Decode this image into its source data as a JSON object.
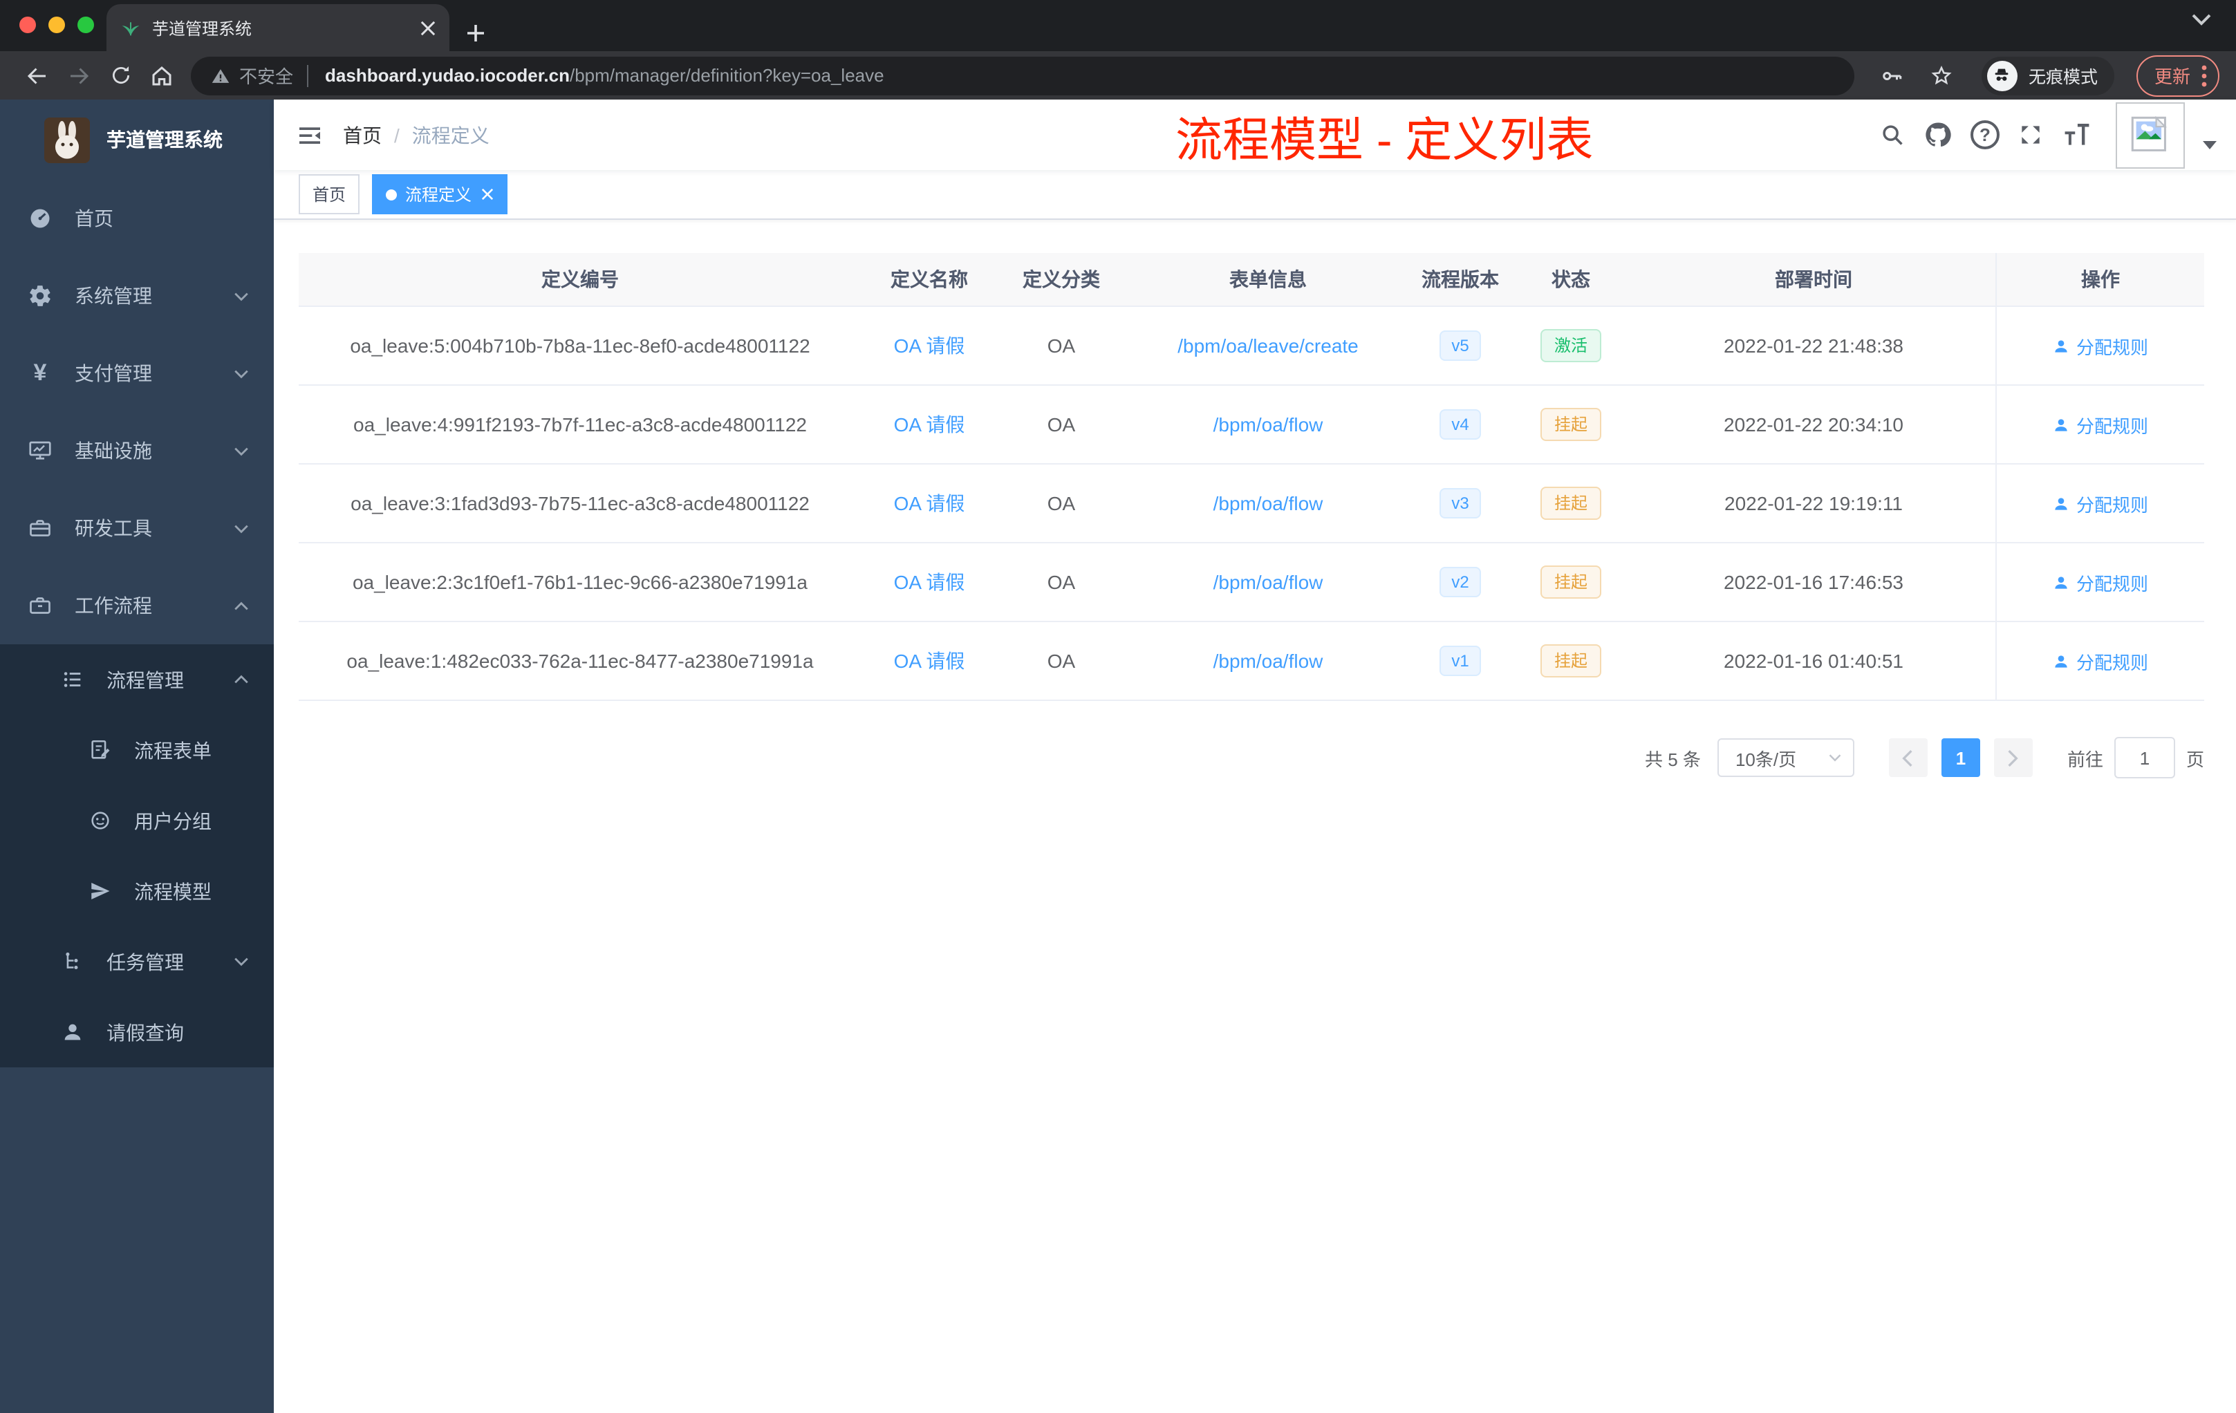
{
  "browser": {
    "tab_title": "芋道管理系统",
    "security_label": "不安全",
    "url_domain": "dashboard.yudao.iocoder.cn",
    "url_path": "/bpm/manager/definition?key=oa_leave",
    "incognito_label": "无痕模式",
    "update_label": "更新"
  },
  "sidebar": {
    "logo_title": "芋道管理系统",
    "items": [
      {
        "label": "首页",
        "icon": "dashboard-icon"
      },
      {
        "label": "系统管理",
        "icon": "gear-icon"
      },
      {
        "label": "支付管理",
        "icon": "yen-icon",
        "glyph": "¥"
      },
      {
        "label": "基础设施",
        "icon": "monitor-icon"
      },
      {
        "label": "研发工具",
        "icon": "toolbox-icon"
      },
      {
        "label": "工作流程",
        "icon": "briefcase-icon"
      }
    ],
    "sub_items": [
      {
        "label": "流程管理",
        "icon": "list-icon"
      },
      {
        "label": "流程表单",
        "icon": "form-icon"
      },
      {
        "label": "用户分组",
        "icon": "robot-icon"
      },
      {
        "label": "流程模型",
        "icon": "paper-plane-icon"
      },
      {
        "label": "任务管理",
        "icon": "tree-icon"
      },
      {
        "label": "请假查询",
        "icon": "user-icon"
      }
    ]
  },
  "navbar": {
    "breadcrumb": {
      "root": "首页",
      "separator": "/",
      "current": "流程定义"
    },
    "annotation": "流程模型 - 定义列表",
    "question_glyph": "?"
  },
  "tags": {
    "home": "首页",
    "active": "流程定义"
  },
  "table": {
    "columns": [
      "定义编号",
      "定义名称",
      "定义分类",
      "表单信息",
      "流程版本",
      "状态",
      "部署时间",
      "操作"
    ],
    "action_label": "分配规则",
    "rows": [
      {
        "id": "oa_leave:5:004b710b-7b8a-11ec-8ef0-acde48001122",
        "name": "OA 请假",
        "category": "OA",
        "form": "/bpm/oa/leave/create",
        "version": "v5",
        "status": {
          "label": "激活",
          "type": "success"
        },
        "deploy_time": "2022-01-22 21:48:38"
      },
      {
        "id": "oa_leave:4:991f2193-7b7f-11ec-a3c8-acde48001122",
        "name": "OA 请假",
        "category": "OA",
        "form": "/bpm/oa/flow",
        "version": "v4",
        "status": {
          "label": "挂起",
          "type": "warning"
        },
        "deploy_time": "2022-01-22 20:34:10"
      },
      {
        "id": "oa_leave:3:1fad3d93-7b75-11ec-a3c8-acde48001122",
        "name": "OA 请假",
        "category": "OA",
        "form": "/bpm/oa/flow",
        "version": "v3",
        "status": {
          "label": "挂起",
          "type": "warning"
        },
        "deploy_time": "2022-01-22 19:19:11"
      },
      {
        "id": "oa_leave:2:3c1f0ef1-76b1-11ec-9c66-a2380e71991a",
        "name": "OA 请假",
        "category": "OA",
        "form": "/bpm/oa/flow",
        "version": "v2",
        "status": {
          "label": "挂起",
          "type": "warning"
        },
        "deploy_time": "2022-01-16 17:46:53"
      },
      {
        "id": "oa_leave:1:482ec033-762a-11ec-8477-a2380e71991a",
        "name": "OA 请假",
        "category": "OA",
        "form": "/bpm/oa/flow",
        "version": "v1",
        "status": {
          "label": "挂起",
          "type": "warning"
        },
        "deploy_time": "2022-01-16 01:40:51"
      }
    ]
  },
  "pagination": {
    "total": "共 5 条",
    "page_size": "10条/页",
    "current_page": "1",
    "jumper_prefix": "前往",
    "jumper_value": "1",
    "jumper_suffix": "页"
  },
  "colors": {
    "accent": "#409eff",
    "success": "#18be6c",
    "warning": "#e6a23c",
    "annotation_red": "#ff2600",
    "sidebar_bg": "#304156",
    "submenu_bg": "#1f2d3d",
    "mac_red": "#ff5f57",
    "mac_yellow": "#febc2e",
    "mac_green": "#28c840"
  }
}
